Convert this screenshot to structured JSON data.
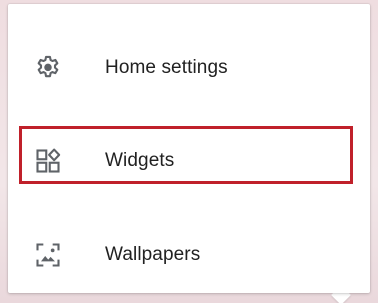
{
  "menu": {
    "items": [
      {
        "label": "Home settings",
        "icon": "gear-icon"
      },
      {
        "label": "Widgets",
        "icon": "widgets-icon"
      },
      {
        "label": "Wallpapers",
        "icon": "wallpaper-icon"
      }
    ],
    "highlighted_item": "Widgets"
  },
  "colors": {
    "highlight_border": "#c0202a",
    "icon": "#5f6368",
    "text": "#212121",
    "background": "#f2e6e8"
  }
}
